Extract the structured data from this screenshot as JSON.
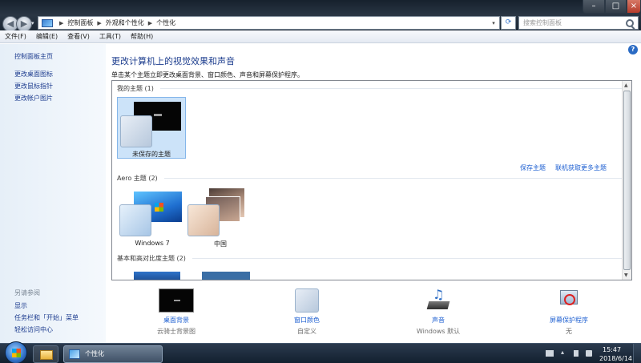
{
  "address": {
    "crumbs": [
      "控制面板",
      "外观和个性化",
      "个性化"
    ],
    "search_placeholder": "搜索控制面板"
  },
  "menu": [
    "文件(F)",
    "编辑(E)",
    "查看(V)",
    "工具(T)",
    "帮助(H)"
  ],
  "sidebar": {
    "links": [
      "控制面板主页",
      "更改桌面图标",
      "更改鼠标指针",
      "更改帐户图片"
    ],
    "see_also_title": "另请参阅",
    "see_also": [
      "显示",
      "任务栏和「开始」菜单",
      "轻松访问中心"
    ]
  },
  "main": {
    "title": "更改计算机上的视觉效果和声音",
    "subtitle": "单击某个主题立即更改桌面背景、窗口颜色、声音和屏幕保护程序。",
    "groups": {
      "my_themes": "我的主题 (1)",
      "aero": "Aero 主题 (2)",
      "basic": "基本和高对比度主题 (2)"
    },
    "themes": {
      "unsaved": "未保存的主题",
      "win7": "Windows 7",
      "china": "中国"
    },
    "actions": {
      "save_theme": "保存主题",
      "get_more": "联机获取更多主题"
    }
  },
  "bottom": {
    "desktop_bg": {
      "label": "桌面背景",
      "sub": "云骑士背景图"
    },
    "window_color": {
      "label": "窗口颜色",
      "sub": "自定义"
    },
    "sounds": {
      "label": "声音",
      "sub": "Windows 默认"
    },
    "screensaver": {
      "label": "屏幕保护程序",
      "sub": "无"
    }
  },
  "taskbar": {
    "active_task": "个性化",
    "time": "15:47",
    "date": "2018/6/14"
  },
  "colors": {
    "link": "#1d5fd1",
    "title": "#1c3d8e",
    "selection": "#cce3f9"
  }
}
